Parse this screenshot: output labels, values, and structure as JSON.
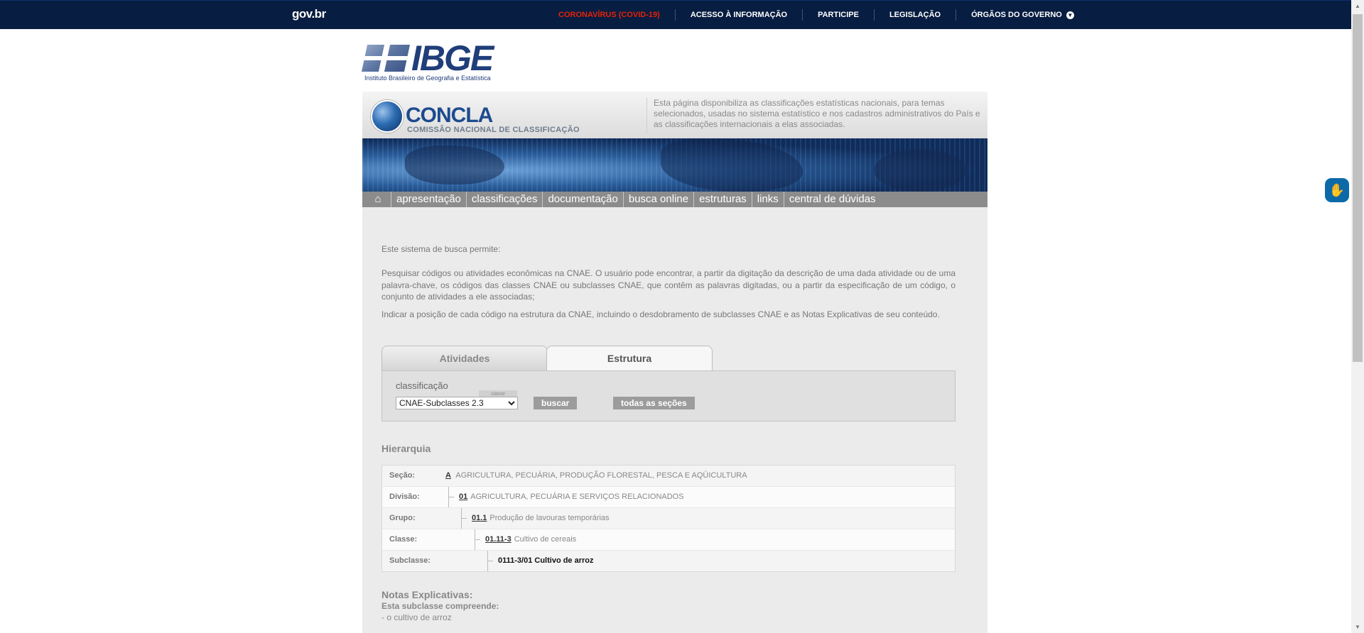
{
  "govbar": {
    "logo": "gov.br",
    "links": [
      "CORONAVÍRUS (COVID-19)",
      "ACESSO À INFORMAÇÃO",
      "PARTICIPE",
      "LEGISLAÇÃO",
      "ÓRGÃOS DO GOVERNO"
    ]
  },
  "ibge": {
    "name": "IBGE",
    "subtitle": "Instituto Brasileiro de Geografia e Estatística"
  },
  "concla": {
    "title": "CONCLA",
    "subtitle": "COMISSÃO NACIONAL DE CLASSIFICAÇÃO",
    "description": "Esta página disponibiliza as classificações estatísticas nacionais, para temas selecionados, usadas no sistema estatístico e nos cadastros administrativos do País e as classificações internacionais a elas associadas."
  },
  "nav": {
    "home_icon": "home-icon",
    "items": [
      "apresentação",
      "classificações",
      "documentação",
      "busca online",
      "estruturas",
      "links",
      "central de dúvidas"
    ]
  },
  "intro": {
    "p1": "Este sistema de busca permite:",
    "p2": "Pesquisar códigos ou atividades econômicas na CNAE. O usuário pode encontrar, a partir da digitação da descrição de uma dada atividade ou de uma palavra-chave, os códigos das classes CNAE ou subclasses CNAE, que contêm as palavras digitadas, ou a partir da especificação de um código, o conjunto de atividades a ele associadas;",
    "p3": "Indicar a posição de cada código na estrutura da CNAE, incluindo o desdobramento de subclasses CNAE e as Notas Explicativas de seu conteúdo."
  },
  "tabs": {
    "inactive": "Atividades",
    "active": "Estrutura"
  },
  "search": {
    "label": "classificação",
    "classe_tag": "classe",
    "selected": "CNAE-Subclasses 2.3",
    "buscar": "buscar",
    "todas": "todas as seções"
  },
  "hierarchy": {
    "heading": "Hierarquia",
    "secao": {
      "label": "Seção:",
      "code": "A",
      "text": "AGRICULTURA, PECUÁRIA, PRODUÇÃO FLORESTAL, PESCA E AQÜICULTURA"
    },
    "divisao": {
      "label": "Divisão:",
      "code": "01",
      "text": "AGRICULTURA, PECUÁRIA E SERVIÇOS RELACIONADOS"
    },
    "grupo": {
      "label": "Grupo:",
      "code": "01.1",
      "text": "Produção de lavouras temporárias"
    },
    "classe": {
      "label": "Classe:",
      "code": "01.11-3",
      "text": "Cultivo de cereais"
    },
    "subclasse": {
      "label": "Subclasse:",
      "text": "0111-3/01 Cultivo de arroz"
    }
  },
  "notes": {
    "heading": "Notas Explicativas:",
    "sub": "Esta subclasse compreende:",
    "item": "- o cultivo de arroz"
  }
}
